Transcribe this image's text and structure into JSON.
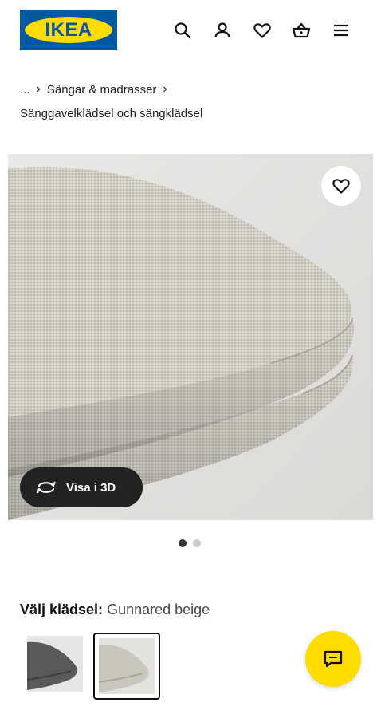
{
  "header": {
    "logo_text": "IKEA",
    "icons": [
      "search-icon",
      "user-icon",
      "heart-icon",
      "basket-icon",
      "menu-icon"
    ]
  },
  "breadcrumb": {
    "ellipsis": "...",
    "category": "Sängar & madrasser",
    "subcategory": "Sänggavelklädsel och sängklädsel"
  },
  "product_image": {
    "view_3d_label": "Visa i 3D",
    "page_indicator": {
      "current": 1,
      "total": 2
    }
  },
  "cover_selector": {
    "label": "Välj klädsel:",
    "value": "Gunnared beige",
    "options": [
      {
        "name": "dark-grey",
        "selected": false
      },
      {
        "name": "beige",
        "selected": true
      }
    ]
  },
  "colors": {
    "ikea_blue": "#0058a3",
    "ikea_yellow": "#ffdb00",
    "dark_button": "#222222"
  }
}
